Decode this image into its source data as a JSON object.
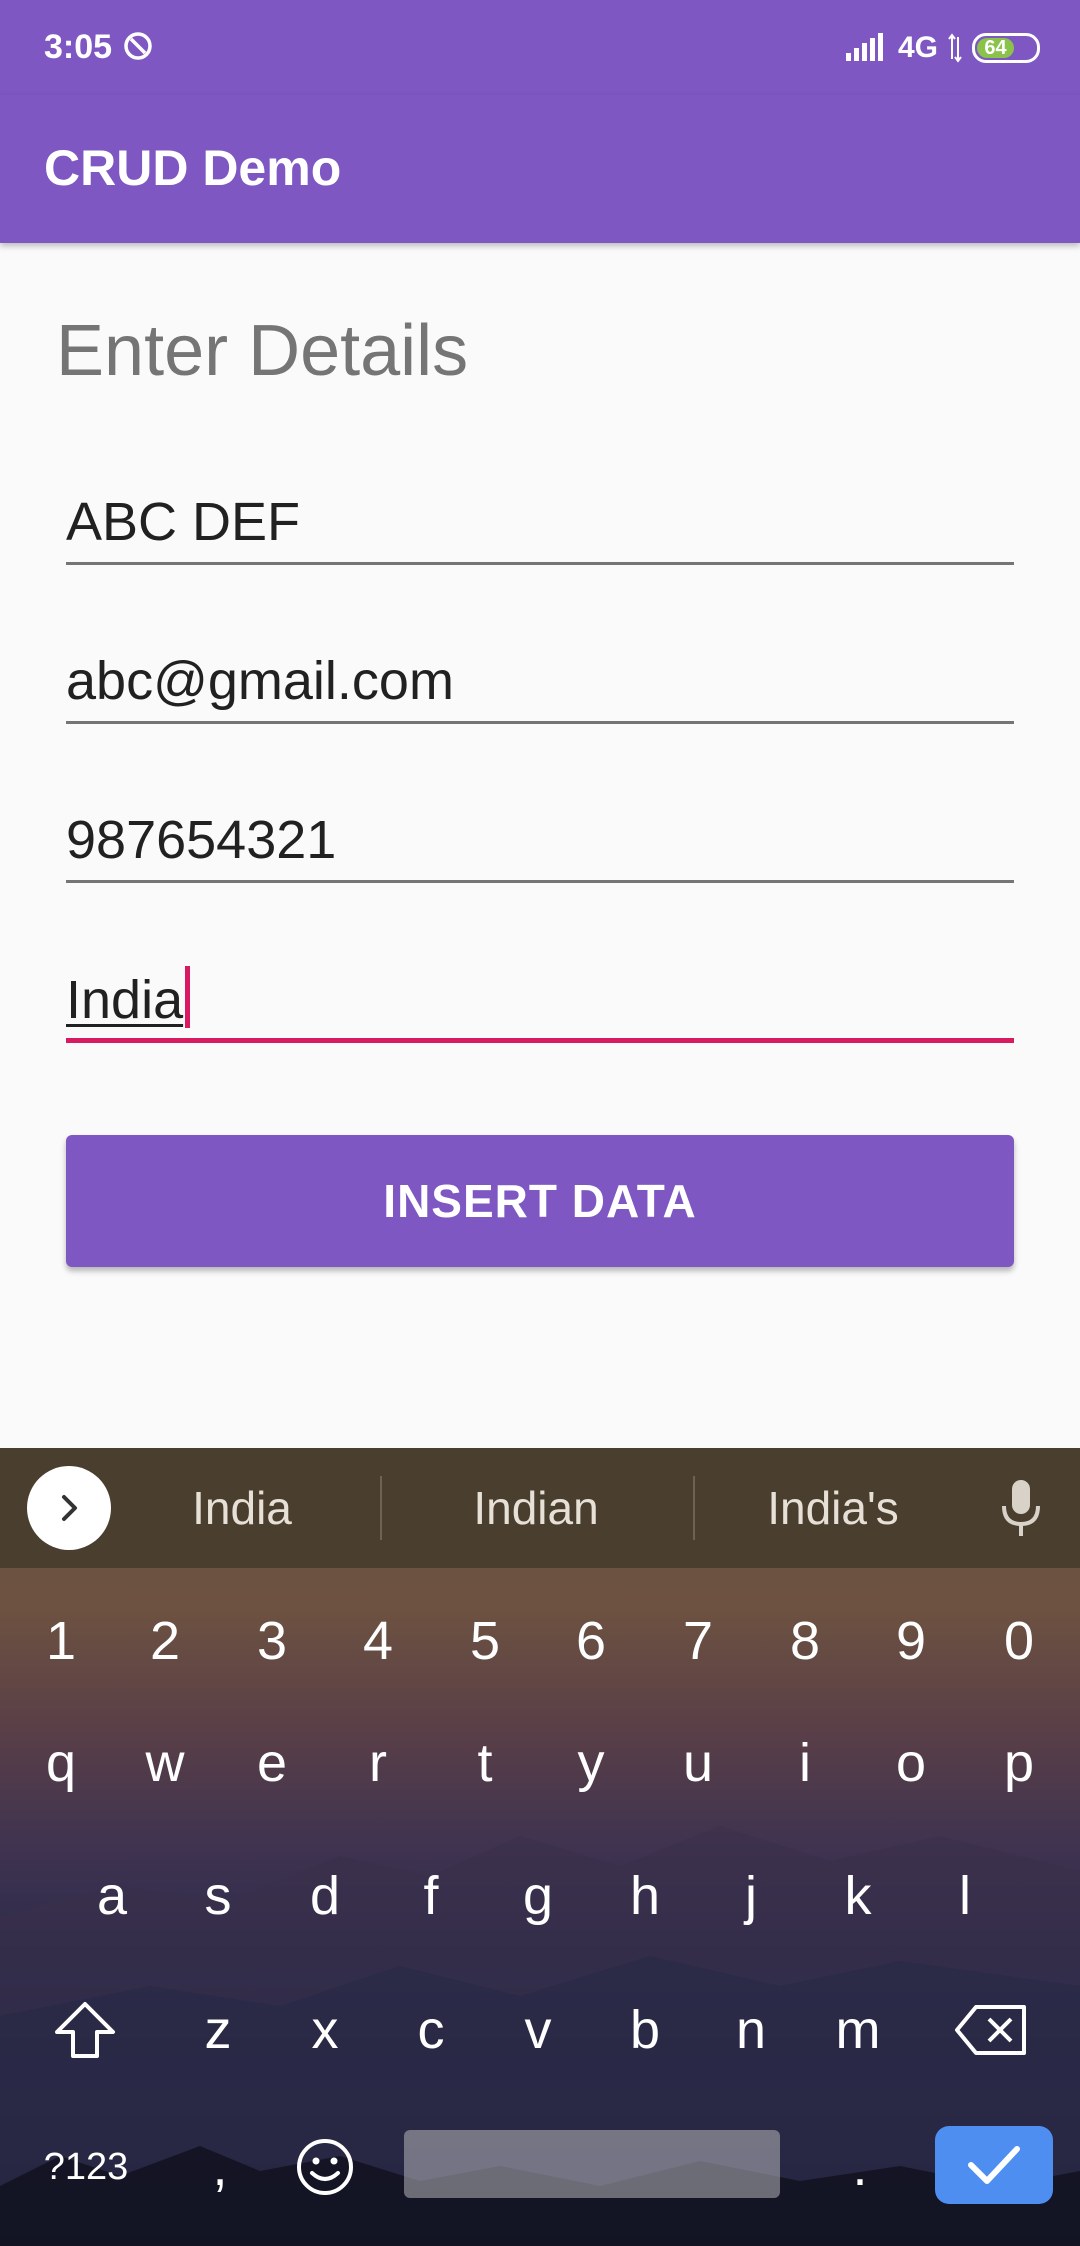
{
  "status_bar": {
    "time": "3:05",
    "network": "4G",
    "battery_level": "64",
    "battery_fraction": 0.64,
    "battery_color": "#8bc34a"
  },
  "app_bar": {
    "title": "CRUD Demo",
    "color": "#7e57c2"
  },
  "form": {
    "heading": "Enter Details",
    "fields": [
      {
        "name": "name",
        "value": "ABC DEF"
      },
      {
        "name": "email",
        "value": "abc@gmail.com"
      },
      {
        "name": "phone",
        "value": "987654321"
      },
      {
        "name": "country",
        "value": "India",
        "focused": true
      }
    ],
    "insert_button": "INSERT DATA",
    "accent_color": "#d81b60"
  },
  "keyboard": {
    "suggestions": [
      "India",
      "Indian",
      "India's"
    ],
    "number_row": [
      "1",
      "2",
      "3",
      "4",
      "5",
      "6",
      "7",
      "8",
      "9",
      "0"
    ],
    "row1": [
      "q",
      "w",
      "e",
      "r",
      "t",
      "y",
      "u",
      "i",
      "o",
      "p"
    ],
    "row2": [
      "a",
      "s",
      "d",
      "f",
      "g",
      "h",
      "j",
      "k",
      "l"
    ],
    "row3": [
      "z",
      "x",
      "c",
      "v",
      "b",
      "n",
      "m"
    ],
    "symbols_key": "?123",
    "comma_key": ",",
    "period_key": ".",
    "icons": {
      "expand": "chevron-right-icon",
      "mic": "mic-icon",
      "shift": "shift-icon",
      "backspace": "backspace-icon",
      "emoji": "emoji-icon",
      "done": "checkmark-icon"
    }
  }
}
